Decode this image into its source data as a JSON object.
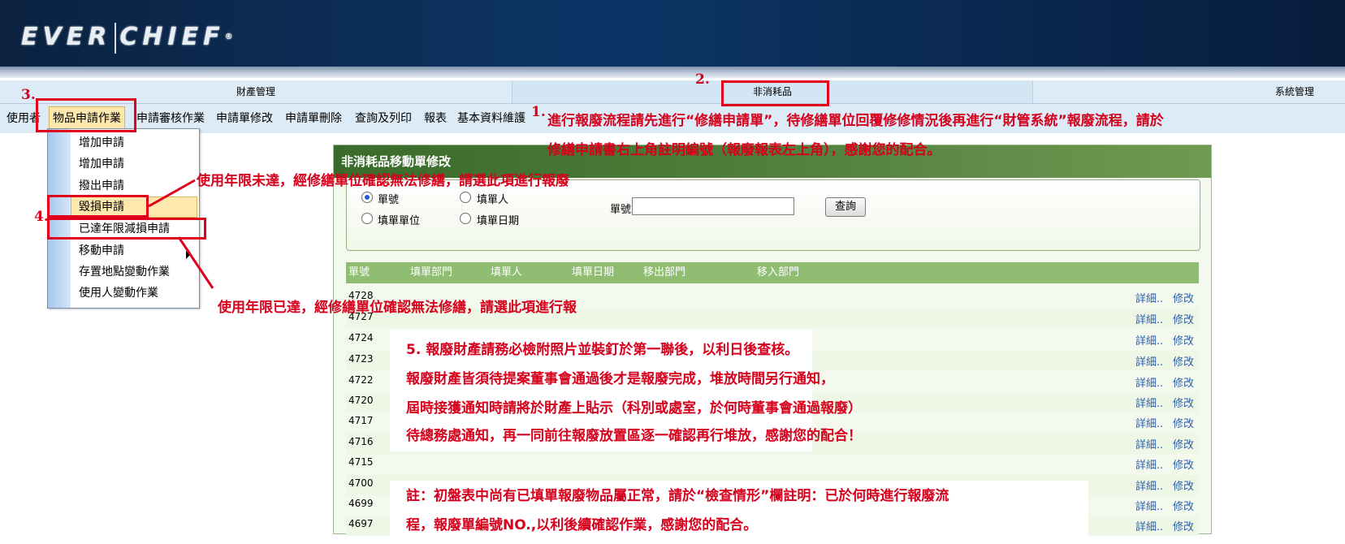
{
  "header": {
    "logo_text": "EVER",
    "logo_text2": "CHIEF",
    "logo_mark": "®"
  },
  "tabs": [
    {
      "label": "財產管理"
    },
    {
      "label": "非消耗品"
    },
    {
      "label": "系統管理"
    }
  ],
  "menu": {
    "items": [
      "使用者",
      "物品申請作業",
      "申請審核作業",
      "申請單修改",
      "申請單刪除",
      "查詢及列印",
      "報表",
      "基本資料維護"
    ]
  },
  "dropdown": {
    "items": [
      "增加申請",
      "增加申請",
      "撥出申請",
      "毀損申請",
      "已達年限減損申請",
      "移動申請",
      "存置地點變動作業",
      "使用人變動作業"
    ]
  },
  "panel": {
    "title": "非消耗品移動單修改",
    "search": {
      "radio_order": "單號",
      "radio_filler": "填單人",
      "radio_unit": "填單單位",
      "radio_date": "填單日期",
      "order_label": "單號：",
      "order_value": "",
      "query_label": "查詢"
    },
    "columns": [
      "單號",
      "填單部門",
      "填單人",
      "填單日期",
      "移出部門",
      "移入部門"
    ],
    "rows": [
      {
        "id": "4728"
      },
      {
        "id": "4727"
      },
      {
        "id": "4724"
      },
      {
        "id": "4723"
      },
      {
        "id": "4722"
      },
      {
        "id": "4720"
      },
      {
        "id": "4717"
      },
      {
        "id": "4716"
      },
      {
        "id": "4715"
      },
      {
        "id": "4700"
      },
      {
        "id": "4699"
      },
      {
        "id": "4697"
      }
    ],
    "detail_label": "詳細..",
    "edit_label": "修改"
  },
  "annotations": {
    "num1": "1.",
    "num2": "2.",
    "num3": "3.",
    "num4": "4.",
    "num5": "5.",
    "note1_line1": "進行報廢流程請先進行“修繕申請單”，待修繕單位回覆修修情況後再進行“財管系統”報廢流程，請於",
    "note1_line2": "修繕申請書右上角註明編號（報廢報表左上角），感謝您的配合。",
    "note_damage": "使用年限未達，經修繕單位確認無法修繕，請選此項進行報廢",
    "note_expired": "使用年限已達，經修繕單位確認無法修繕，請選此項進行報",
    "note5_line1": "報廢財產請務必檢附照片並裝釘於第一聯後，以利日後查核。",
    "note5_line2": "報廢財產皆須待提案董事會通過後才是報廢完成，堆放時間另行通知，",
    "note5_line3": "屆時接獲通知時請將於財產上貼示（科別或處室，於何時董事會通過報廢）",
    "note5_line4": "待總務處通知，再一同前往報廢放置區逐一確認再行堆放，感謝您的配合！",
    "note6_line1": "註：初盤表中尚有已填單報廢物品屬正常，請於“檢查情形”欄註明：已於何時進行報廢流",
    "note6_line2": "程，報廢單編號NO.,以利後續確認作業，感謝您的配合。"
  }
}
